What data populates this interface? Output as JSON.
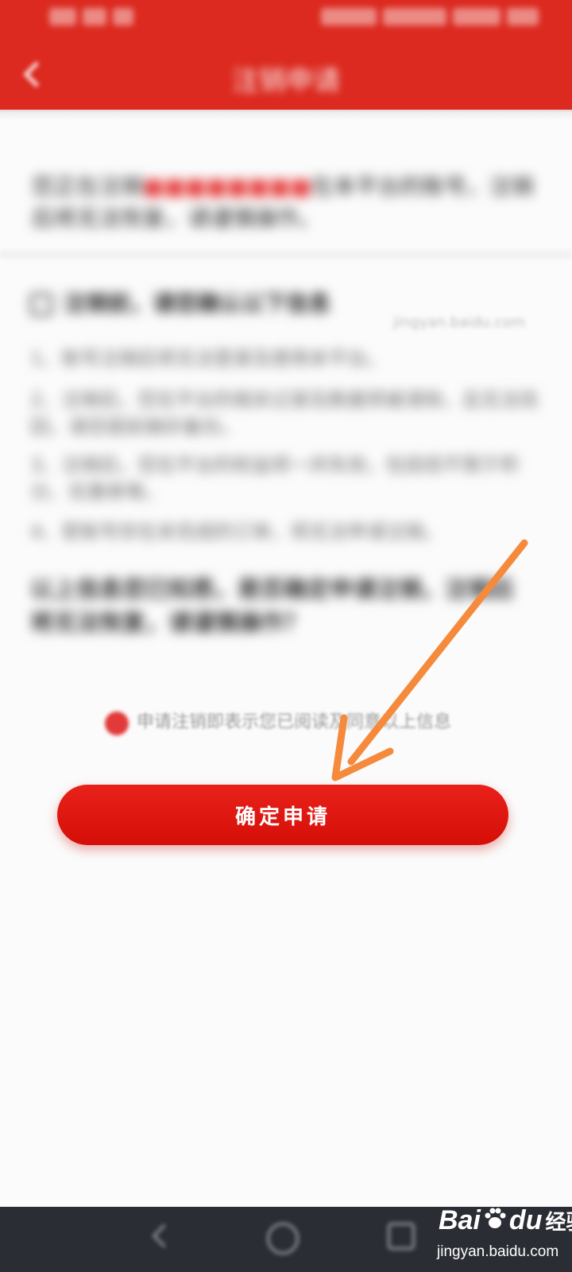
{
  "colors": {
    "header": "#dc2a20",
    "button": "#e0160f",
    "arrow": "#f58a3c",
    "navbar": "#2a2d33"
  },
  "status_bar": {
    "left_icons": [
      "wechat-icon",
      "signal-icon"
    ],
    "right_icons": [
      "wifi-icon",
      "battery-icon"
    ]
  },
  "header": {
    "back_icon": "chevron-left-icon",
    "title": "注销申请"
  },
  "content": {
    "intro_prefix": "您正在注销",
    "intro_highlight": "■■■■■■■■",
    "intro_suffix": "在本平台的账号，注销后将无法恢复，请谨慎操作。",
    "section_title": "注销前，请您确认以下信息",
    "notes": [
      "1、账号注销后将无法登录及使用本平台。",
      "2、注销后，您在平台的相关记录及数据将被清除，且无法找回，请您提前做好备份。",
      "3、注销后，您在平台的权益将一并失效，包括但不限于积分、优惠券等。",
      "4、若账号存在未完成的订单，将无法申请注销。"
    ],
    "confirm_question": "以上信息您已知悉，是否确定申请注销，注销后将无法恢复，请谨慎操作？",
    "watermark_mark": "jingyan.baidu.com"
  },
  "agreement": {
    "text": "申请注销即表示您已阅读及同意以上信息"
  },
  "confirm_button": {
    "label": "确定申请"
  },
  "navbar": {
    "icons": [
      "back-triangle-icon",
      "home-circle-icon",
      "recent-square-icon"
    ]
  },
  "watermark": {
    "logo_bai": "Bai",
    "logo_du": "du",
    "logo_cn": "经验",
    "url": "jingyan.baidu.com"
  }
}
